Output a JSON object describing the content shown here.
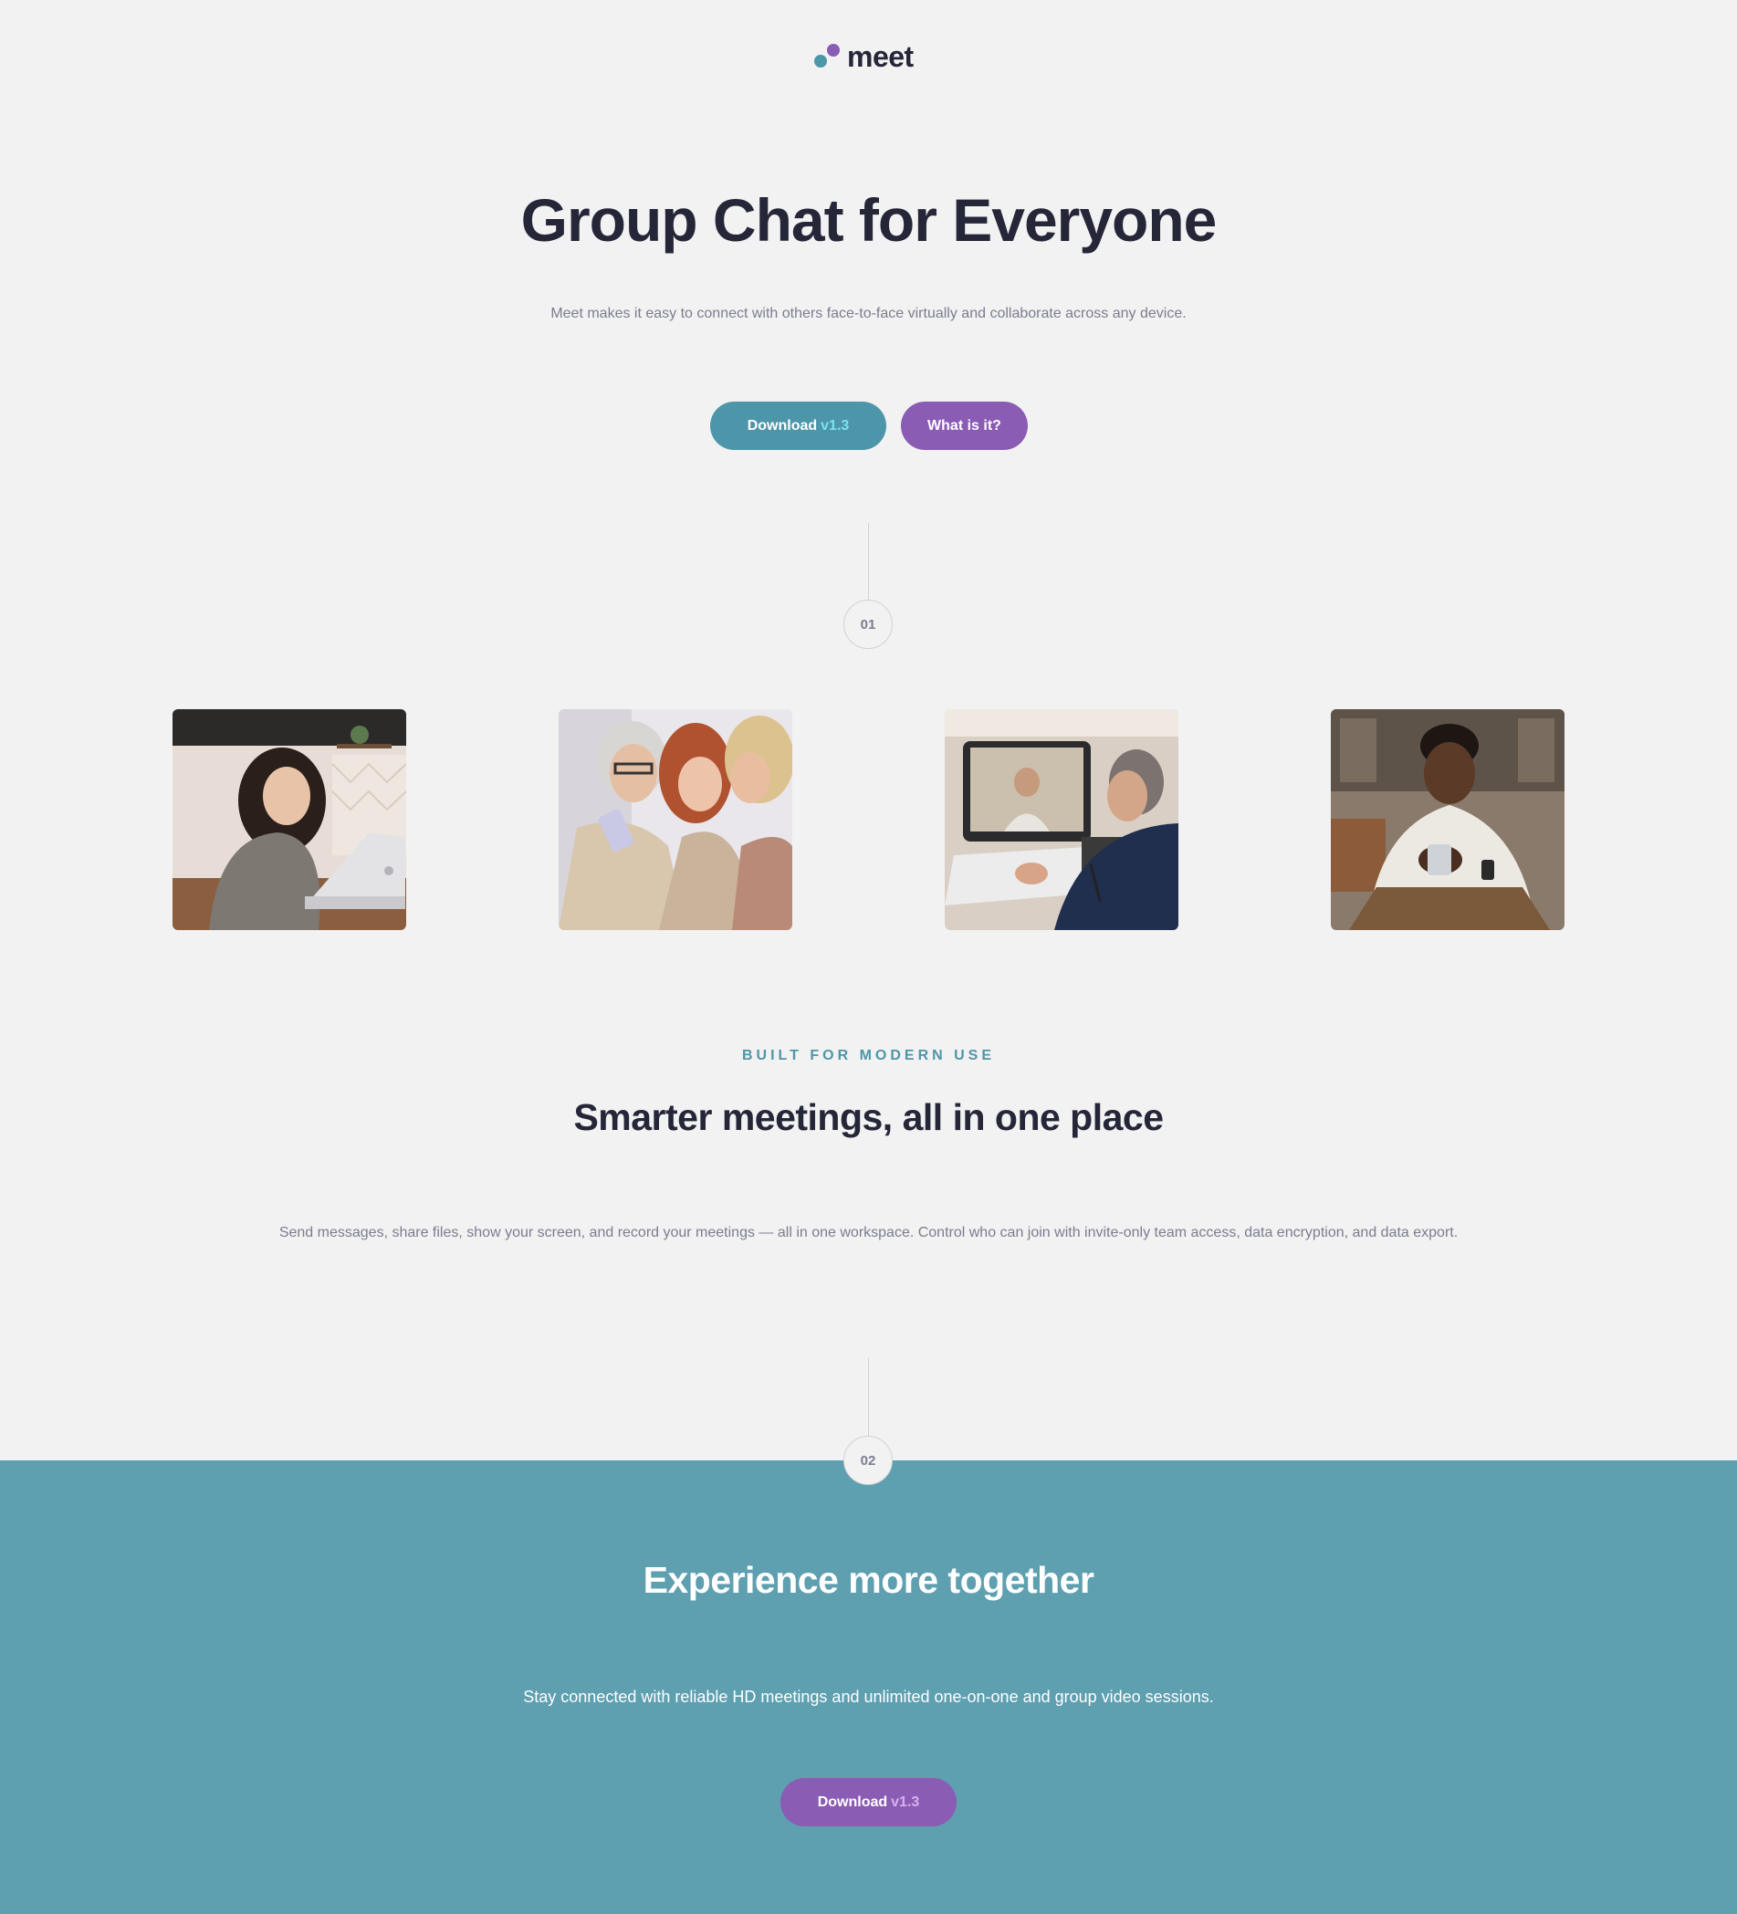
{
  "brand": {
    "name": "meet",
    "colors": {
      "teal": "#4d96a9",
      "purple": "#8b5cb4",
      "dark": "#252638",
      "band": "#5e9fb0"
    }
  },
  "hero": {
    "title": "Group Chat for Everyone",
    "subtitle": "Meet makes it easy to connect with others face-to-face virtually and collaborate across any device.",
    "primary_button": {
      "label": "Download",
      "version": "v1.3"
    },
    "secondary_button": {
      "label": "What is it?"
    }
  },
  "steps": {
    "first": "01",
    "second": "02"
  },
  "photos": [
    {
      "icon": "woman-laptop-photo"
    },
    {
      "icon": "women-phone-photo"
    },
    {
      "icon": "man-video-call-photo"
    },
    {
      "icon": "man-phone-photo"
    }
  ],
  "features": {
    "eyebrow": "BUILT FOR MODERN USE",
    "title": "Smarter meetings, all in one place",
    "body": "Send messages, share files, show your screen, and record your meetings — all in one workspace. Control who can join with invite-only team access, data encryption, and data export."
  },
  "cta": {
    "title": "Experience more together",
    "subtitle": "Stay connected with reliable HD meetings and unlimited one-on-one and group video sessions.",
    "button": {
      "label": "Download",
      "version": "v1.3"
    }
  }
}
